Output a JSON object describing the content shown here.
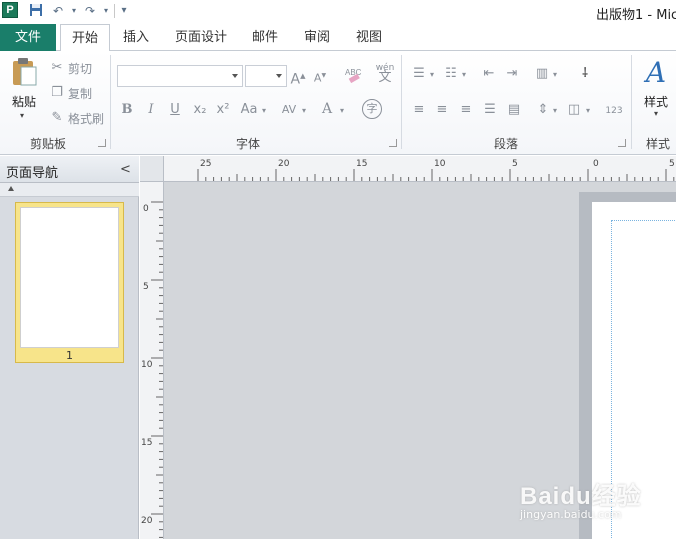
{
  "titlebar": {
    "app_icon": "P",
    "quick_access": [
      "save-icon",
      "undo-icon",
      "redo-icon",
      "customize-icon"
    ],
    "doc_title": "出版物1 - Mic"
  },
  "tabs": {
    "file": "文件",
    "items": [
      "开始",
      "插入",
      "页面设计",
      "邮件",
      "审阅",
      "视图"
    ],
    "active": "开始"
  },
  "ribbon": {
    "clipboard": {
      "paste": "粘贴",
      "cut": "剪切",
      "copy": "复制",
      "format_painter": "格式刷",
      "label": "剪贴板"
    },
    "font": {
      "font_name": "",
      "font_size": "",
      "label": "字体",
      "bold": "B",
      "italic": "I",
      "underline": "U",
      "subscript": "x₂",
      "superscript": "x²",
      "change_case": "Aa",
      "char_spacing": "AV",
      "font_color": "A",
      "phonetic": "wén\n文",
      "enclose": "字"
    },
    "paragraph": {
      "label": "段落",
      "line_spacing_value": "123"
    },
    "styles": {
      "button": "样式",
      "label": "样式"
    }
  },
  "nav_panel": {
    "title": "页面导航",
    "collapse": "<",
    "page_number": "1"
  },
  "hruler": {
    "labels": [
      "25",
      "20",
      "15",
      "10",
      "5",
      "0",
      "5"
    ]
  },
  "vruler": {
    "labels": [
      "0",
      "5",
      "10",
      "15",
      "20"
    ]
  },
  "watermark": {
    "logo": "Baidu经验",
    "url": "jingyan.baidu.com"
  }
}
